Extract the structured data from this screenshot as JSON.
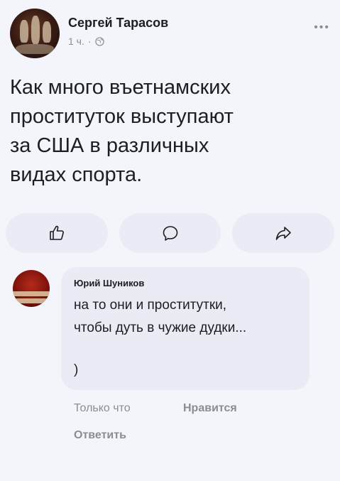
{
  "post": {
    "author": "Сергей Тарасов",
    "time": "1 ч.",
    "separator": "·",
    "privacy_icon": "globe-icon",
    "more_icon": "more-dots-icon",
    "more_label": "•••",
    "text": "Как много въетнамских\nпроституток выступают\nза США в различных\nвидах спорта."
  },
  "actions": [
    {
      "icon": "like-thumb-icon"
    },
    {
      "icon": "comment-icon"
    },
    {
      "icon": "share-icon"
    }
  ],
  "comment": {
    "author": "Юрий Шуников",
    "text": "на то они и проститутки,\nчтобы дуть в чужие дудки...",
    "extra": ")",
    "time": "Только что",
    "like_label": "Нравится",
    "reply_label": "Ответить"
  },
  "colors": {
    "background": "#f4f5fb",
    "bubble": "#e9ebf5",
    "secondary_text": "#8a8d91"
  }
}
